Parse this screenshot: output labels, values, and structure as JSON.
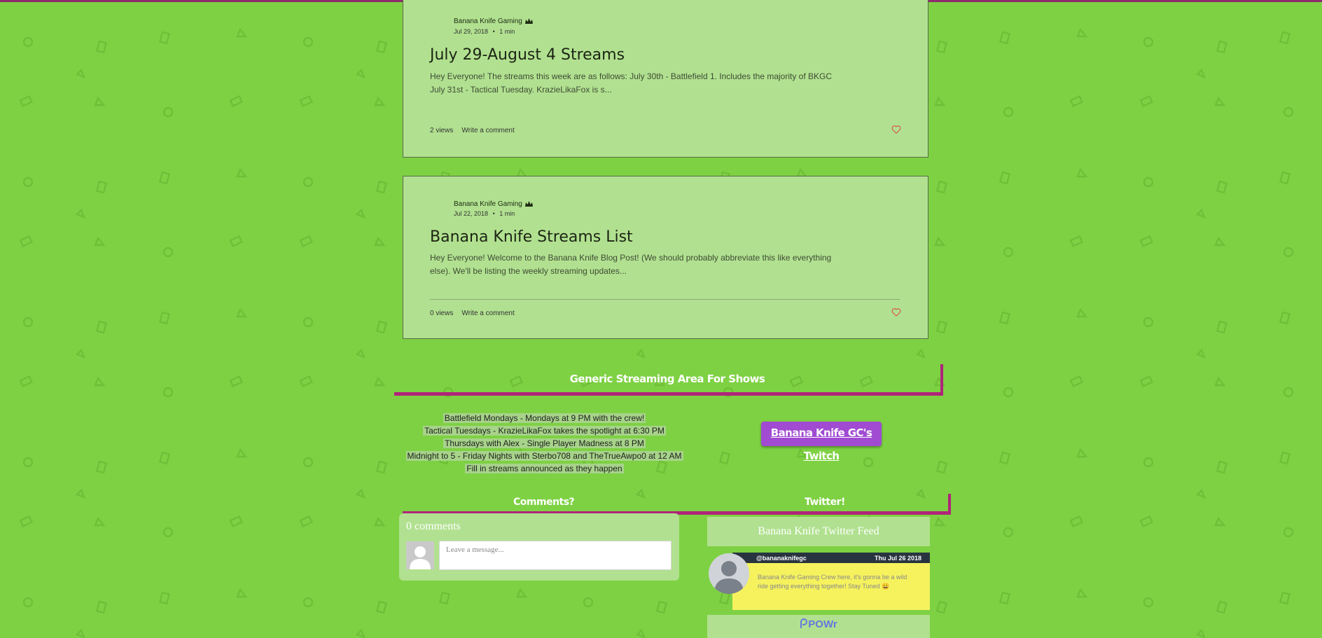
{
  "posts": [
    {
      "author": "Banana Knife Gaming",
      "date": "Jul 29, 2018",
      "read_time": "1 min",
      "title": "July 29-August 4 Streams",
      "excerpt": "Hey Everyone! The streams this week are as follows: July 30th - Battlefield 1. Includes the majority of BKGC July 31st - Tactical Tuesday. KrazieLikaFox is s...",
      "views": "2 views",
      "comment_link": "Write a comment"
    },
    {
      "author": "Banana Knife Gaming",
      "date": "Jul 22, 2018",
      "read_time": "1 min",
      "title": "Banana Knife Streams List",
      "excerpt": "Hey Everyone! Welcome to the Banana Knife Blog Post! (We should probably abbreviate this like everything else). We'll be listing the weekly streaming updates...",
      "views": "0 views",
      "comment_link": "Write a comment"
    }
  ],
  "meta_separator": "•",
  "streaming": {
    "heading": "Generic Streaming Area For Shows",
    "schedule": [
      "Battlefield Mondays - Mondays at 9 PM with the crew!",
      "Tactical Tuesdays - KrazieLikaFox takes the spotlight at 6:30 PM",
      "Thursdays with Alex - Single Player Madness at 8 PM",
      "Midnight to 5 - Friday Nights with Sterbo708 and TheTrueAwpo0 at 12 AM",
      "Fill in streams announced as they happen"
    ],
    "twitch_button": "Banana Knife GC's Twitch"
  },
  "bottom": {
    "comments_heading": "Comments?",
    "twitter_heading": "Twitter!"
  },
  "comments": {
    "count": "0 comments",
    "placeholder": "Leave a message..."
  },
  "twitter": {
    "header": "Banana Knife Twitter Feed",
    "handle": "@bananaknifegc",
    "date": "Thu Jul 26 2018",
    "tweet": "Banana Knife Gaming Crew here, it's gonna be a wild ride getting everything together! Stay Tuned 😀",
    "footer": "POWr"
  },
  "colors": {
    "page_bg": "#7ed143",
    "card_bg": "#b1e190",
    "accent_magenta": "#b0247a",
    "twitch_purple": "#a04bd2",
    "tweet_yellow": "#f5f25e",
    "heart_red": "#d9534f"
  }
}
